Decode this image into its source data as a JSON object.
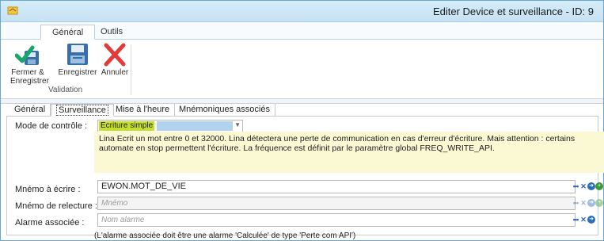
{
  "window": {
    "title": "Editer Device et surveillance - ID: 9"
  },
  "ribbon": {
    "tabs": [
      "Général",
      "Outils"
    ],
    "buttons": {
      "save_close": "Fermer &\nEnregistrer",
      "save": "Enregistrer",
      "cancel": "Annuler"
    },
    "group_label": "Validation"
  },
  "tabs": [
    "Général",
    "Surveillance",
    "Mise à l'heure",
    "Mnémoniques associés"
  ],
  "form": {
    "control_mode": {
      "label": "Mode de contrôle :",
      "value": "Ecriture simple"
    },
    "info_text": "Lina Ecrit un mot entre 0 et 32000. Lina détectera une perte de communication en cas d'erreur d'écriture. Mais attention : certains automate en stop permettent l'écriture. La fréquence est définit par le paramètre global FREQ_WRITE_API.",
    "mnemo_write": {
      "label": "Mnémo à écrire :",
      "value": "EWON.MOT_DE_VIE"
    },
    "mnemo_read": {
      "label": "Mnémo de relecture :",
      "placeholder": "Mnémo"
    },
    "alarm": {
      "label": "Alarme associée :",
      "placeholder": "Nom alarme"
    },
    "note": "(L'alarme associée doit être une alarme 'Calculée' de type 'Perte com API')"
  },
  "colors": {
    "title_bar": "#c6e2f3",
    "combo_selection": "#c6df27",
    "info_background": "#fbf8d4",
    "accent_blue": "#2d63b4"
  },
  "icons": [
    "app-icon",
    "save-close-icon",
    "save-icon",
    "cancel-icon",
    "browse-icon",
    "clear-icon",
    "navigate-icon",
    "add-icon"
  ]
}
